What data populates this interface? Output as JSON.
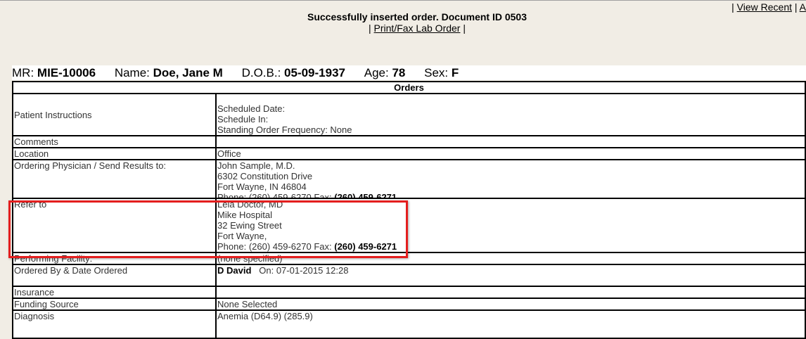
{
  "top_links": {
    "view_recent": "View Recent",
    "next_initial": "A"
  },
  "message": {
    "text": "Successfully inserted order. Document ID 0503",
    "print_link": "Print/Fax Lab Order"
  },
  "patient": {
    "mr_label": "MR:",
    "mr": "MIE-10006",
    "name_label": "Name:",
    "name": "Doe, Jane M",
    "dob_label": "D.O.B.:",
    "dob": "05-09-1937",
    "age_label": "Age:",
    "age": "78",
    "sex_label": "Sex:",
    "sex": "F"
  },
  "orders": {
    "title": "Orders",
    "patient_instructions": {
      "label": "Patient Instructions",
      "scheduled_date": "Scheduled Date:",
      "schedule_in": "Schedule In:",
      "standing_order": "Standing Order Frequency: None"
    },
    "comments": {
      "label": "Comments",
      "value": ""
    },
    "location": {
      "label": "Location",
      "value": "Office"
    },
    "ordering_physician": {
      "label": "Ordering Physician / Send Results to:",
      "name": "John Sample, M.D.",
      "address1": "6302 Constitution Drive",
      "address2": "Fort Wayne, IN 46804",
      "phone": "Phone: (260) 459-6270 Fax: ",
      "fax": "(260) 459-6271"
    },
    "refer_to": {
      "label": "Refer to",
      "name": "Lela Doctor, MD",
      "facility": "Mike Hospital",
      "address1": "32 Ewing Street",
      "address2": "Fort Wayne,",
      "phone": "Phone: (260) 459-6270 Fax: ",
      "fax": "(260) 459-6271"
    },
    "performing_facility": {
      "label": "Performing Facility:",
      "value": "(none specified)"
    },
    "ordered_by": {
      "label": "Ordered By & Date Ordered",
      "name": "D David",
      "date": "On: 07-01-2015 12:28"
    },
    "insurance": {
      "label": "Insurance",
      "value": ""
    },
    "funding_source": {
      "label": "Funding Source",
      "value": "None Selected"
    },
    "diagnosis": {
      "label": "Diagnosis",
      "value": "Anemia (D64.9) (285.9)"
    }
  },
  "highlight_color": "#e41e1e"
}
